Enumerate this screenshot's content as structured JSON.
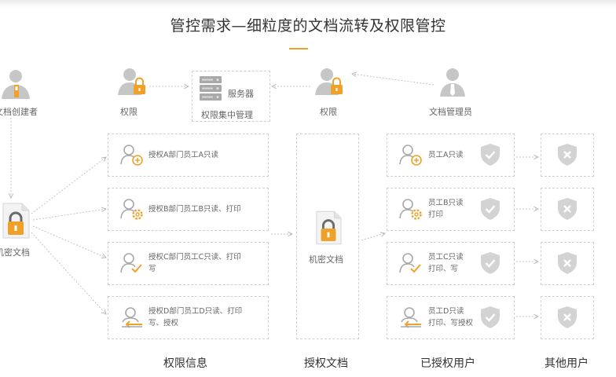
{
  "title": "管控需求—细粒度的文档流转及权限管控",
  "top": {
    "creator": "文档创建者",
    "perm_left": "权限",
    "server_name": "服务器",
    "server_caption": "权限集中管理",
    "perm_right": "权限",
    "admin": "文档管理员"
  },
  "left_doc": "机密文档",
  "center_doc": "机密文档",
  "permissions": [
    {
      "line1": "授权A部门员工A只读",
      "line2": ""
    },
    {
      "line1": "授权B部门员工B只读、打印",
      "line2": ""
    },
    {
      "line1": "授权C部门员工C只读、打印",
      "line2": "写"
    },
    {
      "line1": "授权D部门员工D只读、打印",
      "line2": "写、授权"
    }
  ],
  "users": [
    {
      "line1": "员工A只读",
      "line2": ""
    },
    {
      "line1": "员工B只读",
      "line2": "打印"
    },
    {
      "line1": "员工C只读",
      "line2": "打印、写"
    },
    {
      "line1": "员工D只读",
      "line2": "打印、写授权"
    }
  ],
  "categories": {
    "permission_info": "权限信息",
    "authorized_doc": "授权文档",
    "authorized_users": "已授权用户",
    "other_users": "其他用户"
  },
  "colors": {
    "accent": "#f0a12a",
    "icon_gray": "#c6c6c6",
    "border": "#cfcfcf"
  }
}
